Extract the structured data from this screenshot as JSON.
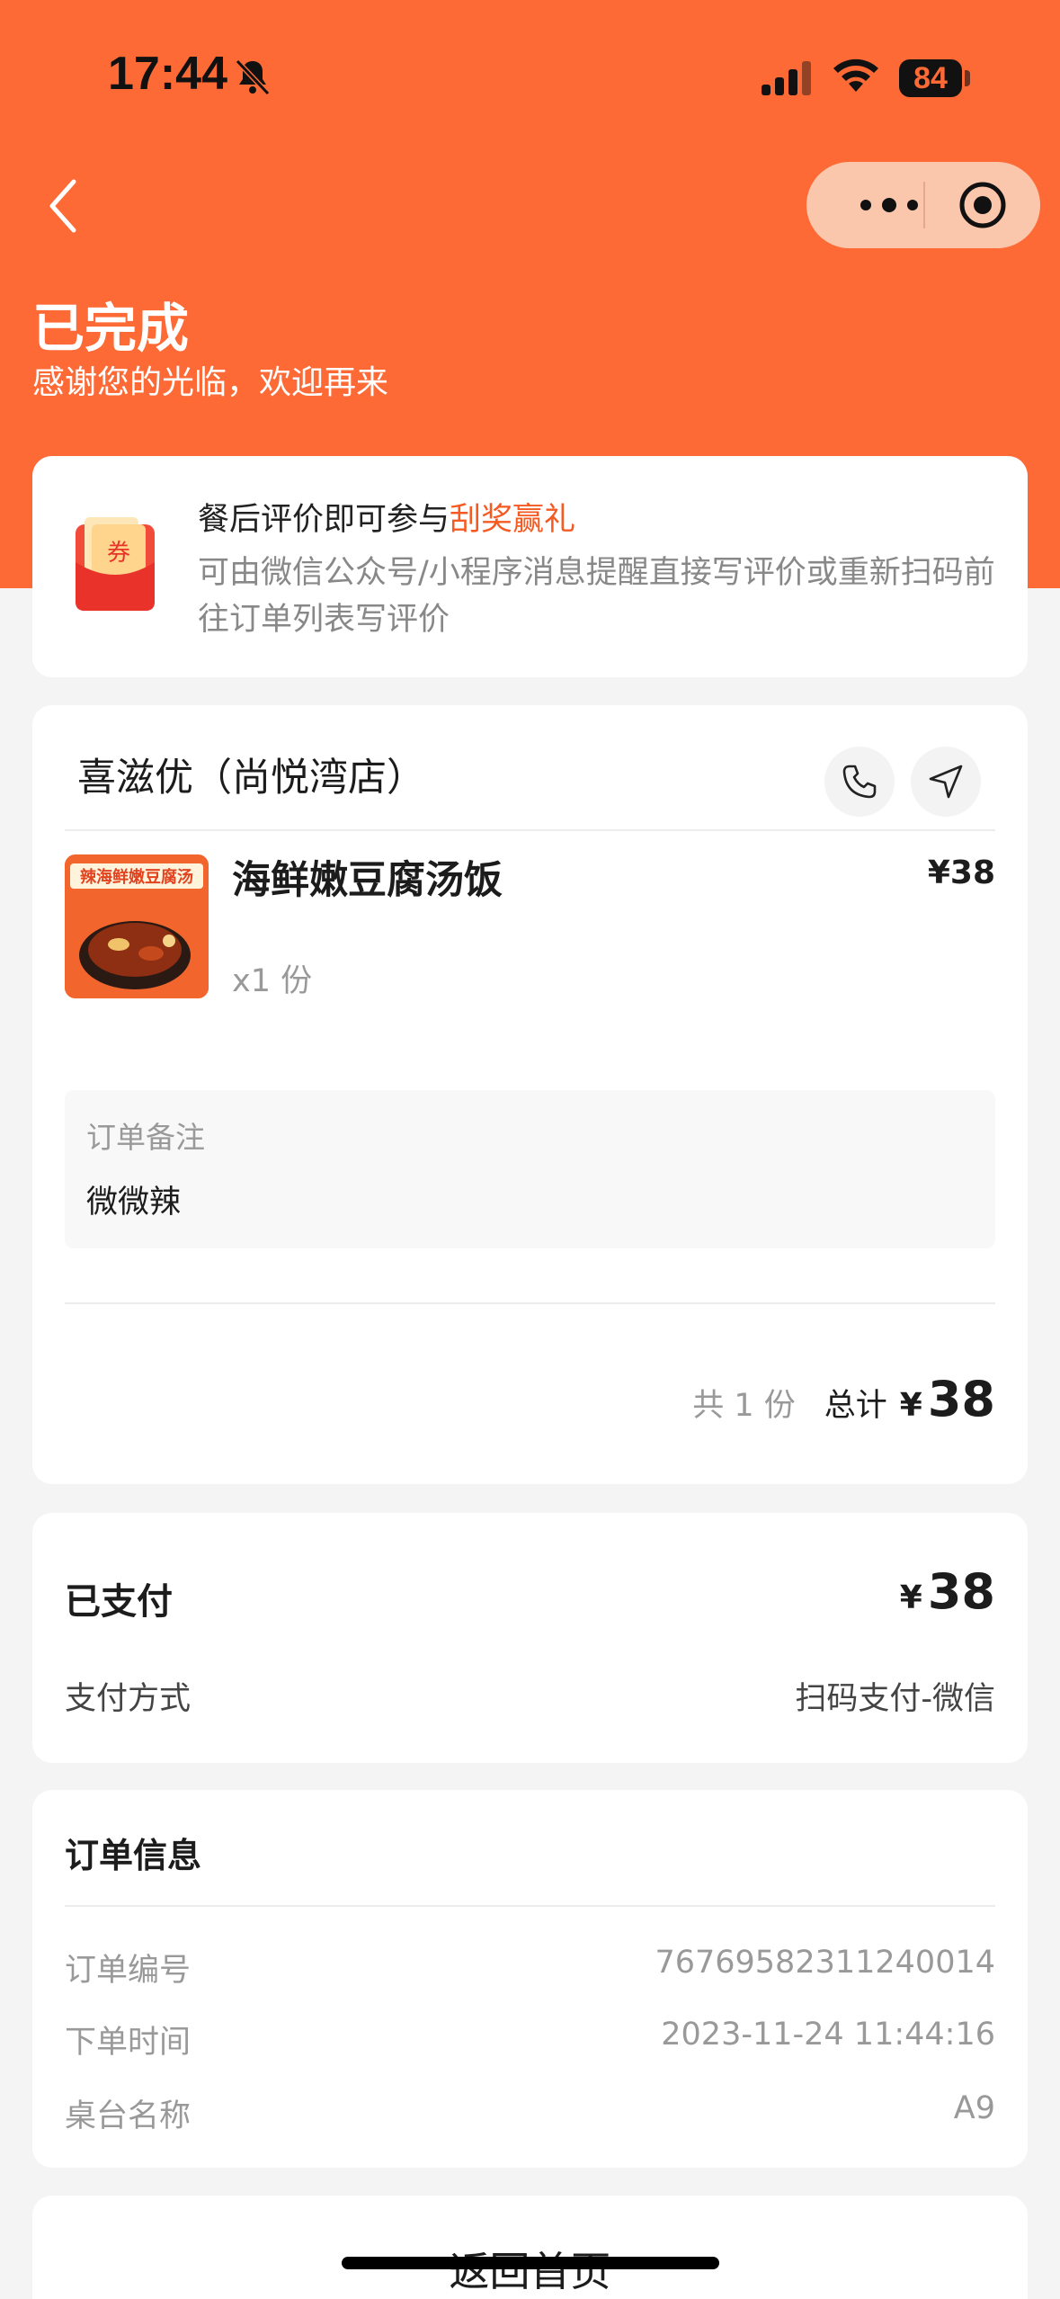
{
  "status_bar": {
    "time": "17:44",
    "battery": "84"
  },
  "header": {
    "status_title": "已完成",
    "status_subtitle": "感谢您的光临，欢迎再来"
  },
  "promo": {
    "title_prefix": "餐后评价即可参与",
    "title_highlight": "刮奖赢礼",
    "description": "可由微信公众号/小程序消息提醒直接写评价或重新扫码前往订单列表写评价",
    "icon_text": "券"
  },
  "order": {
    "store_name": "喜滋优（尚悦湾店）",
    "items": [
      {
        "name": "海鲜嫩豆腐汤饭",
        "price": "¥38",
        "quantity": "x1 份",
        "image_label": "辣海鲜嫩豆腐汤"
      }
    ],
    "remark_label": "订单备注",
    "remark_value": "微微辣",
    "total_count": "共 1 份",
    "total_label": "总计",
    "total_currency": "¥",
    "total_amount": "38"
  },
  "payment": {
    "status_label": "已支付",
    "currency": "¥",
    "amount": "38",
    "method_label": "支付方式",
    "method_value": "扫码支付-微信"
  },
  "order_info": {
    "title": "订单信息",
    "rows": [
      {
        "label": "订单编号",
        "value": "7676958231124001​4"
      },
      {
        "label": "下单时间",
        "value": "2023-11-24 11:44:16"
      },
      {
        "label": "桌台名称",
        "value": "A9"
      }
    ]
  },
  "footer": {
    "home_button": "返回首页"
  },
  "colors": {
    "brand": "#fd6a36",
    "highlight": "#f55a23",
    "page_bg": "#f4f4f4"
  }
}
